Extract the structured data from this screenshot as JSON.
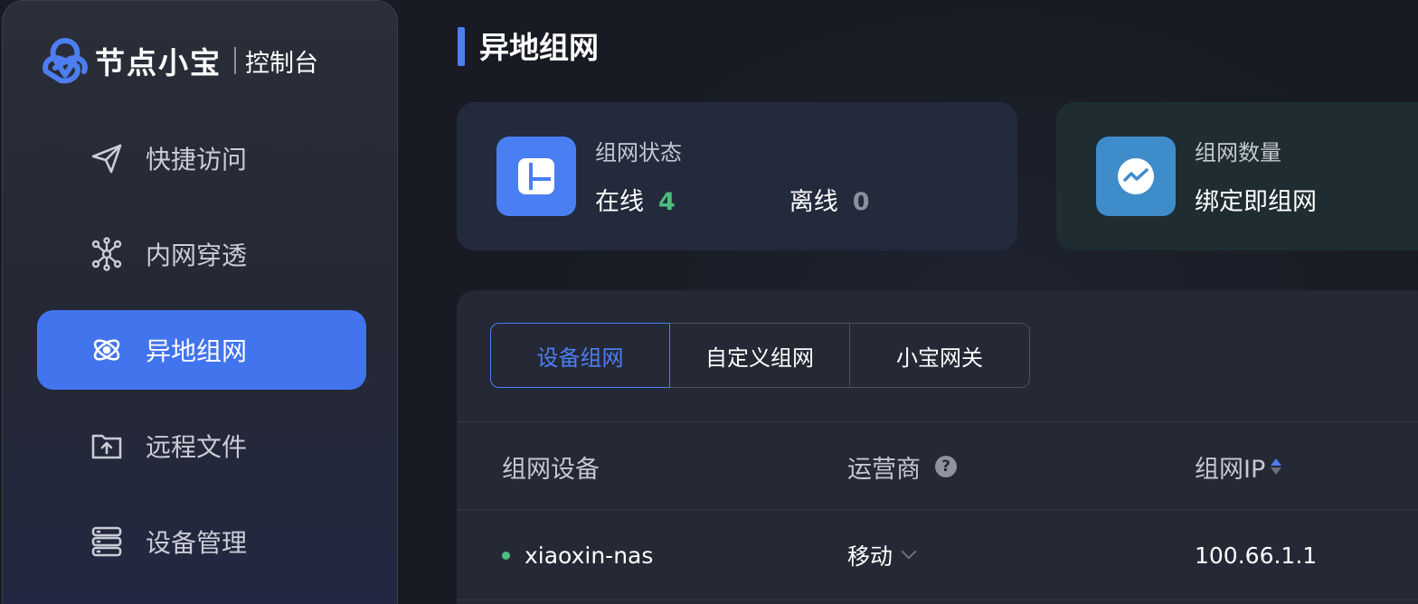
{
  "brand": {
    "name": "节点小宝",
    "subtitle": "控制台",
    "logo_icon": "trefoil-logo-icon",
    "accent_color": "#4274ee"
  },
  "sidebar": {
    "items": [
      {
        "label": "快捷访问",
        "icon": "paper-plane-icon",
        "active": false
      },
      {
        "label": "内网穿透",
        "icon": "network-nodes-icon",
        "active": false
      },
      {
        "label": "异地组网",
        "icon": "atom-orbit-icon",
        "active": true
      },
      {
        "label": "远程文件",
        "icon": "folder-upload-icon",
        "active": false
      },
      {
        "label": "设备管理",
        "icon": "server-stack-icon",
        "active": false
      }
    ]
  },
  "page": {
    "title": "异地组网"
  },
  "status_card": {
    "label": "组网状态",
    "icon": "dashboard-layout-icon",
    "online_label": "在线",
    "online_value": "4",
    "offline_label": "离线",
    "offline_value": "0",
    "online_color": "#4bbd7d"
  },
  "count_card": {
    "label": "组网数量",
    "icon": "trend-line-icon",
    "value": "绑定即组网"
  },
  "tabs": [
    {
      "label": "设备组网",
      "active": true
    },
    {
      "label": "自定义组网",
      "active": false
    },
    {
      "label": "小宝网关",
      "active": false
    }
  ],
  "table": {
    "headers": {
      "device": "组网设备",
      "isp": "运营商",
      "ip": "组网IP"
    },
    "help_icon": "question-circle-icon",
    "sort_icon": "sort-icon",
    "rows": [
      {
        "device": "xiaoxin-nas",
        "isp": "移动",
        "ip": "100.66.1.1",
        "online": true
      }
    ]
  }
}
